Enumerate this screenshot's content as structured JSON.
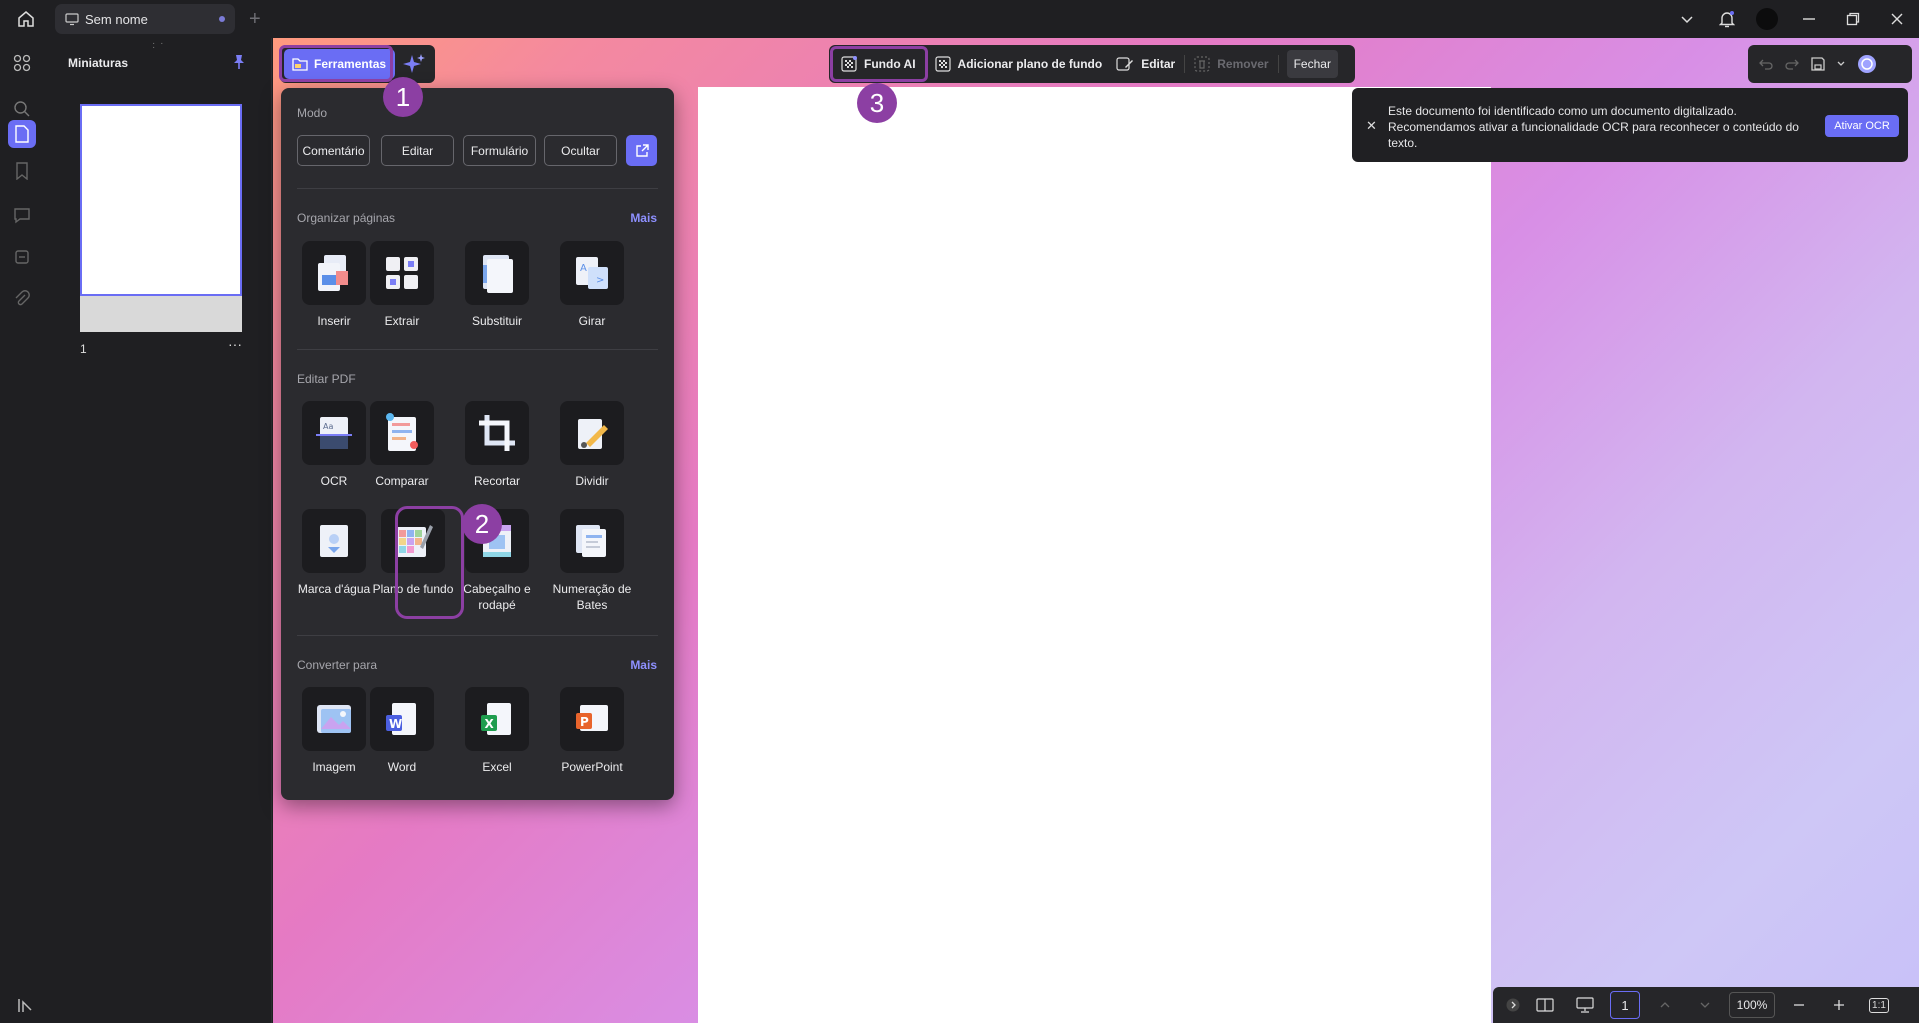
{
  "titlebar": {
    "tab_title": "Sem nome",
    "new_tab_glyph": "+"
  },
  "thumbnails": {
    "title": "Miniaturas",
    "page_number": "1",
    "more_glyph": "···"
  },
  "toolbar": {
    "tools_label": "Ferramentas",
    "fundo_ai_label": "Fundo AI",
    "add_background_label": "Adicionar plano de fundo",
    "edit_label": "Editar",
    "remove_label": "Remover",
    "close_label": "Fechar"
  },
  "notice": {
    "message": "Este documento foi identificado como um documento digitalizado. Recomendamos ativar a funcionalidade OCR para reconhecer o conteúdo do texto.",
    "action_label": "Ativar OCR",
    "close_glyph": "✕"
  },
  "menu": {
    "mode_title": "Modo",
    "modes": [
      "Comentário",
      "Editar",
      "Formulário",
      "Ocultar"
    ],
    "organize_title": "Organizar páginas",
    "organize_more": "Mais",
    "organize_tools": [
      "Inserir",
      "Extrair",
      "Substituir",
      "Girar"
    ],
    "edit_title": "Editar PDF",
    "edit_tools": [
      "OCR",
      "Comparar",
      "Recortar",
      "Dividir"
    ],
    "edit_tools2": [
      "Marca d'água",
      "Plano de fundo",
      "Cabeçalho e rodapé",
      "Numeração de Bates"
    ],
    "convert_title": "Converter para",
    "convert_more": "Mais",
    "convert_tools": [
      "Imagem",
      "Word",
      "Excel",
      "PowerPoint"
    ]
  },
  "annotations": {
    "badge1": "1",
    "badge2": "2",
    "badge3": "3"
  },
  "statusbar": {
    "page_number": "1",
    "zoom": "100%",
    "fit_label": "1:1"
  },
  "colors": {
    "accent": "#6a6df4",
    "annotation": "#8c3fa3",
    "panel": "#2b2b2f"
  }
}
